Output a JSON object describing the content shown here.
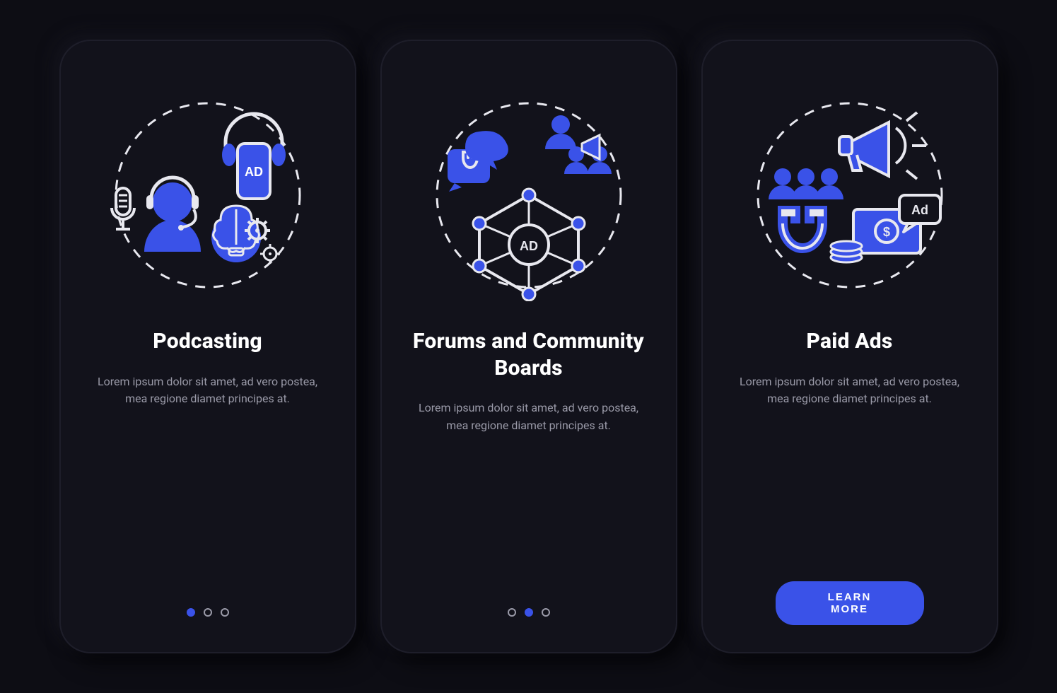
{
  "accent": "#3a52e8",
  "stroke": "#e8e8ef",
  "screens": [
    {
      "title": "Podcasting",
      "description": "Lorem ipsum dolor sit amet, ad vero postea, mea regione diamet principes at.",
      "active_dot": 0,
      "icon_label_top": "AD",
      "has_cta": false
    },
    {
      "title": "Forums and Community Boards",
      "description": "Lorem ipsum dolor sit amet, ad vero postea, mea regione diamet principes at.",
      "active_dot": 1,
      "icon_label_center": "AD",
      "has_cta": false
    },
    {
      "title": "Paid Ads",
      "description": "Lorem ipsum dolor sit amet, ad vero postea, mea regione diamet principes at.",
      "active_dot": 2,
      "icon_label_bubble": "Ad",
      "has_cta": true,
      "cta_label": "LEARN MORE"
    }
  ],
  "dot_count": 3
}
